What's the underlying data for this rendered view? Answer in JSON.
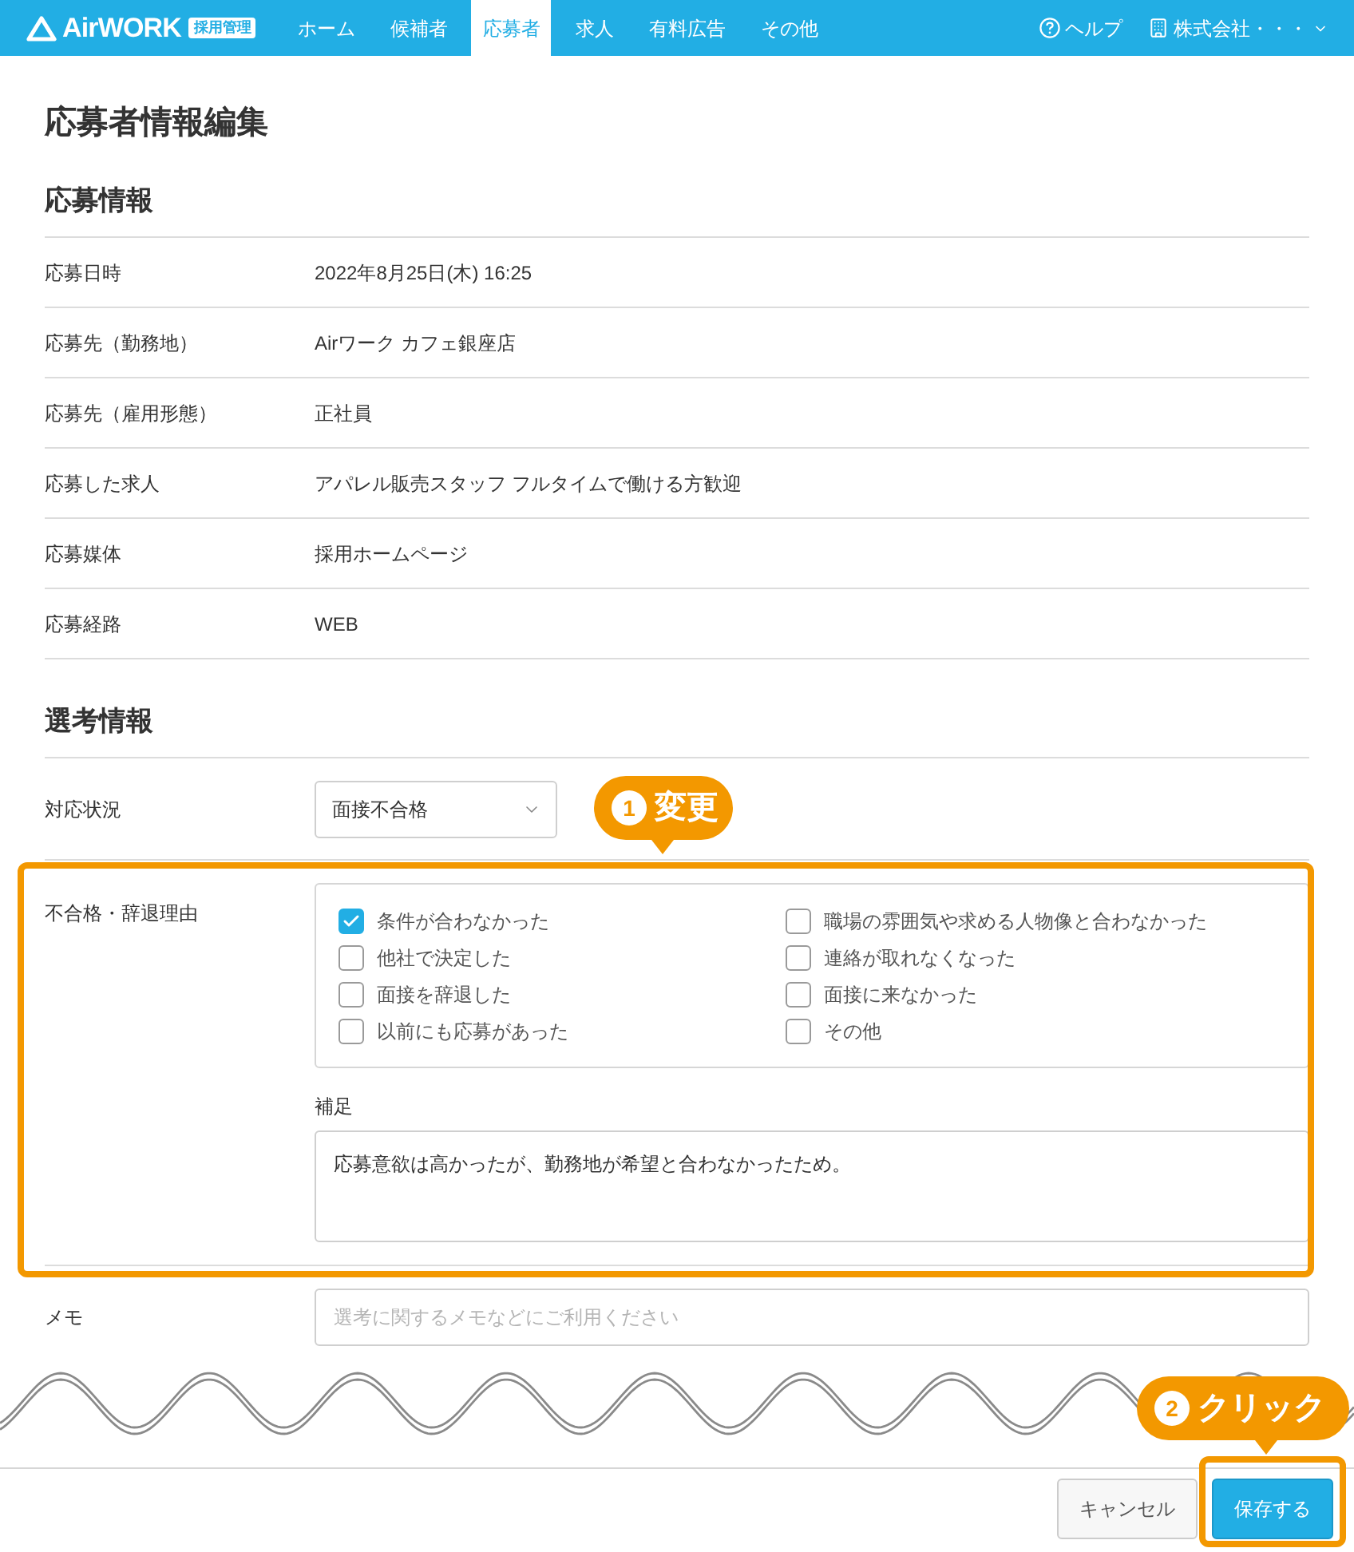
{
  "header": {
    "logo": "AirWORK",
    "logo_badge": "採用管理",
    "nav": [
      {
        "label": "ホーム",
        "selected": false
      },
      {
        "label": "候補者",
        "selected": false
      },
      {
        "label": "応募者",
        "selected": true
      },
      {
        "label": "求人",
        "selected": false
      },
      {
        "label": "有料広告",
        "selected": false
      },
      {
        "label": "その他",
        "selected": false
      }
    ],
    "help": "ヘルプ",
    "account": "株式会社・・・"
  },
  "page_title": "応募者情報編集",
  "application_section": {
    "title": "応募情報",
    "rows": [
      {
        "label": "応募日時",
        "value": "2022年8月25日(木) 16:25"
      },
      {
        "label": "応募先（勤務地）",
        "value": "Airワーク カフェ銀座店"
      },
      {
        "label": "応募先（雇用形態）",
        "value": "正社員"
      },
      {
        "label": "応募した求人",
        "value": "アパレル販売スタッフ フルタイムで働ける方歓迎"
      },
      {
        "label": "応募媒体",
        "value": "採用ホームページ"
      },
      {
        "label": "応募経路",
        "value": "WEB"
      }
    ]
  },
  "screening_section": {
    "title": "選考情報",
    "status": {
      "label": "対応状況",
      "value": "面接不合格"
    },
    "reasons": {
      "label": "不合格・辞退理由",
      "options": [
        {
          "label": "条件が合わなかった",
          "checked": true
        },
        {
          "label": "職場の雰囲気や求める人物像と合わなかった",
          "checked": false
        },
        {
          "label": "他社で決定した",
          "checked": false
        },
        {
          "label": "連絡が取れなくなった",
          "checked": false
        },
        {
          "label": "面接を辞退した",
          "checked": false
        },
        {
          "label": "面接に来なかった",
          "checked": false
        },
        {
          "label": "以前にも応募があった",
          "checked": false
        },
        {
          "label": "その他",
          "checked": false
        }
      ],
      "note_label": "補足",
      "note_value": "応募意欲は高かったが、勤務地が希望と合わなかったため。"
    },
    "memo": {
      "label": "メモ",
      "placeholder": "選考に関するメモなどにご利用ください"
    }
  },
  "footer": {
    "buttons": [
      {
        "label": "キャンセル",
        "kind": "secondary"
      },
      {
        "label": "保存する",
        "kind": "primary"
      }
    ]
  },
  "annotations": [
    {
      "number": "1",
      "text": "変更"
    },
    {
      "number": "2",
      "text": "クリック"
    }
  ]
}
